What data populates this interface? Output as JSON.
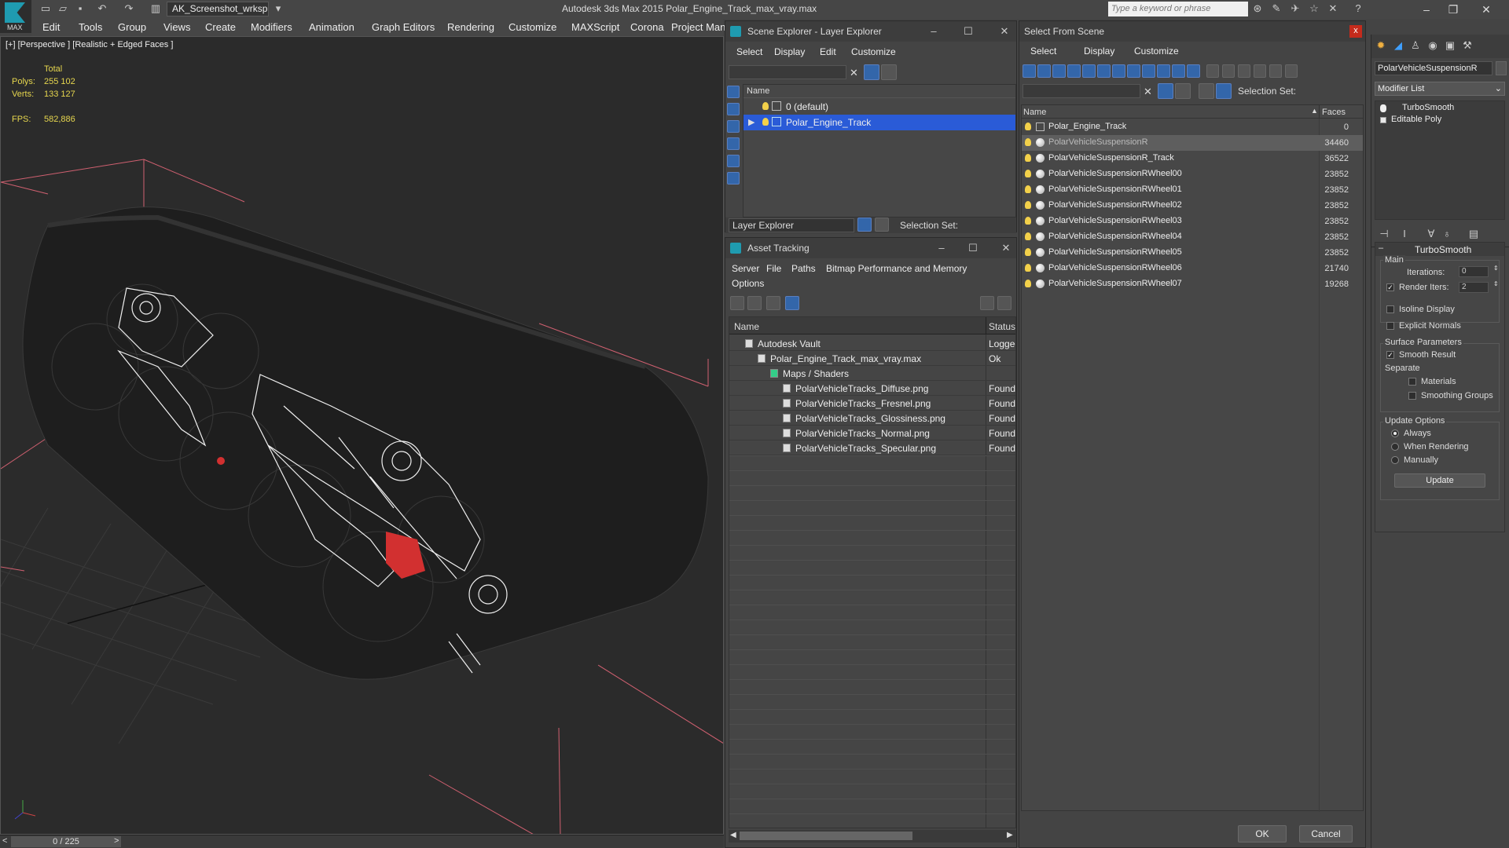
{
  "app": {
    "title": "Autodesk 3ds Max  2015    Polar_Engine_Track_max_vray.max",
    "logo_text": "MAX",
    "workspace": "AK_Screenshot_wrksp",
    "search_placeholder": "Type a keyword or phrase"
  },
  "menu": [
    "Edit",
    "Tools",
    "Group",
    "Views",
    "Create",
    "Modifiers",
    "Animation",
    "Graph Editors",
    "Rendering",
    "Customize",
    "MAXScript",
    "Corona",
    "Project Man"
  ],
  "viewport": {
    "label": "[+] [Perspective ] [Realistic + Edged Faces ]",
    "stats": {
      "total_label": "Total",
      "polys_label": "Polys:",
      "polys_value": "255 102",
      "verts_label": "Verts:",
      "verts_value": "133 127",
      "fps_label": "FPS:",
      "fps_value": "582,886"
    }
  },
  "timeline": {
    "frame": "0 / 225",
    "prev": "<",
    "next": ">"
  },
  "layer_explorer": {
    "title": "Scene Explorer - Layer Explorer",
    "menu": [
      "Select",
      "Display",
      "Edit",
      "Customize"
    ],
    "column": "Name",
    "rows": [
      {
        "name": "0 (default)",
        "selected": false
      },
      {
        "name": "Polar_Engine_Track",
        "selected": true
      }
    ],
    "footer_label": "Layer Explorer",
    "selection_set": "Selection Set:"
  },
  "asset_tracking": {
    "title": "Asset Tracking",
    "menu": [
      "Server",
      "File",
      "Paths",
      "Bitmap Performance and Memory"
    ],
    "menu2": "Options",
    "col_name": "Name",
    "col_status": "Status",
    "rows": [
      {
        "name": "Autodesk Vault",
        "status": "Logged",
        "indent": 0
      },
      {
        "name": "Polar_Engine_Track_max_vray.max",
        "status": "Ok",
        "indent": 1
      },
      {
        "name": "Maps / Shaders",
        "status": "",
        "indent": 2
      },
      {
        "name": "PolarVehicleTracks_Diffuse.png",
        "status": "Found",
        "indent": 3
      },
      {
        "name": "PolarVehicleTracks_Fresnel.png",
        "status": "Found",
        "indent": 3
      },
      {
        "name": "PolarVehicleTracks_Glossiness.png",
        "status": "Found",
        "indent": 3
      },
      {
        "name": "PolarVehicleTracks_Normal.png",
        "status": "Found",
        "indent": 3
      },
      {
        "name": "PolarVehicleTracks_Specular.png",
        "status": "Found",
        "indent": 3
      }
    ]
  },
  "select_from_scene": {
    "title": "Select From Scene",
    "close": "x",
    "menu": [
      "Select",
      "Display",
      "Customize"
    ],
    "selection_set": "Selection Set:",
    "col_name": "Name",
    "col_faces": "Faces",
    "rows": [
      {
        "name": "Polar_Engine_Track",
        "faces": "0",
        "selected": false
      },
      {
        "name": "PolarVehicleSuspensionR",
        "faces": "34460",
        "selected": true
      },
      {
        "name": "PolarVehicleSuspensionR_Track",
        "faces": "36522",
        "selected": false
      },
      {
        "name": "PolarVehicleSuspensionRWheel00",
        "faces": "23852",
        "selected": false
      },
      {
        "name": "PolarVehicleSuspensionRWheel01",
        "faces": "23852",
        "selected": false
      },
      {
        "name": "PolarVehicleSuspensionRWheel02",
        "faces": "23852",
        "selected": false
      },
      {
        "name": "PolarVehicleSuspensionRWheel03",
        "faces": "23852",
        "selected": false
      },
      {
        "name": "PolarVehicleSuspensionRWheel04",
        "faces": "23852",
        "selected": false
      },
      {
        "name": "PolarVehicleSuspensionRWheel05",
        "faces": "23852",
        "selected": false
      },
      {
        "name": "PolarVehicleSuspensionRWheel06",
        "faces": "21740",
        "selected": false
      },
      {
        "name": "PolarVehicleSuspensionRWheel07",
        "faces": "19268",
        "selected": false
      }
    ],
    "ok": "OK",
    "cancel": "Cancel"
  },
  "command_panel": {
    "object_name": "PolarVehicleSuspensionR",
    "modifier_list": "Modifier List",
    "stack": [
      "TurboSmooth",
      "Editable Poly"
    ],
    "rollout_title": "TurboSmooth",
    "main_label": "Main",
    "iterations_label": "Iterations:",
    "iterations_value": "0",
    "render_iters_label": "Render Iters:",
    "render_iters_value": "2",
    "isoline": "Isoline Display",
    "explicit_normals": "Explicit Normals",
    "surface_params": "Surface Parameters",
    "smooth_result": "Smooth Result",
    "separate": "Separate",
    "materials": "Materials",
    "smoothing_groups": "Smoothing Groups",
    "update_options": "Update Options",
    "always": "Always",
    "when_rendering": "When Rendering",
    "manually": "Manually",
    "update_btn": "Update",
    "render_iters_checked": true,
    "smooth_result_checked": true
  },
  "colors": {
    "accent": "#1f9bb0",
    "selection": "#2a5bd7",
    "stat_text": "#e6d64e",
    "wire_highlight": "#e03030"
  }
}
